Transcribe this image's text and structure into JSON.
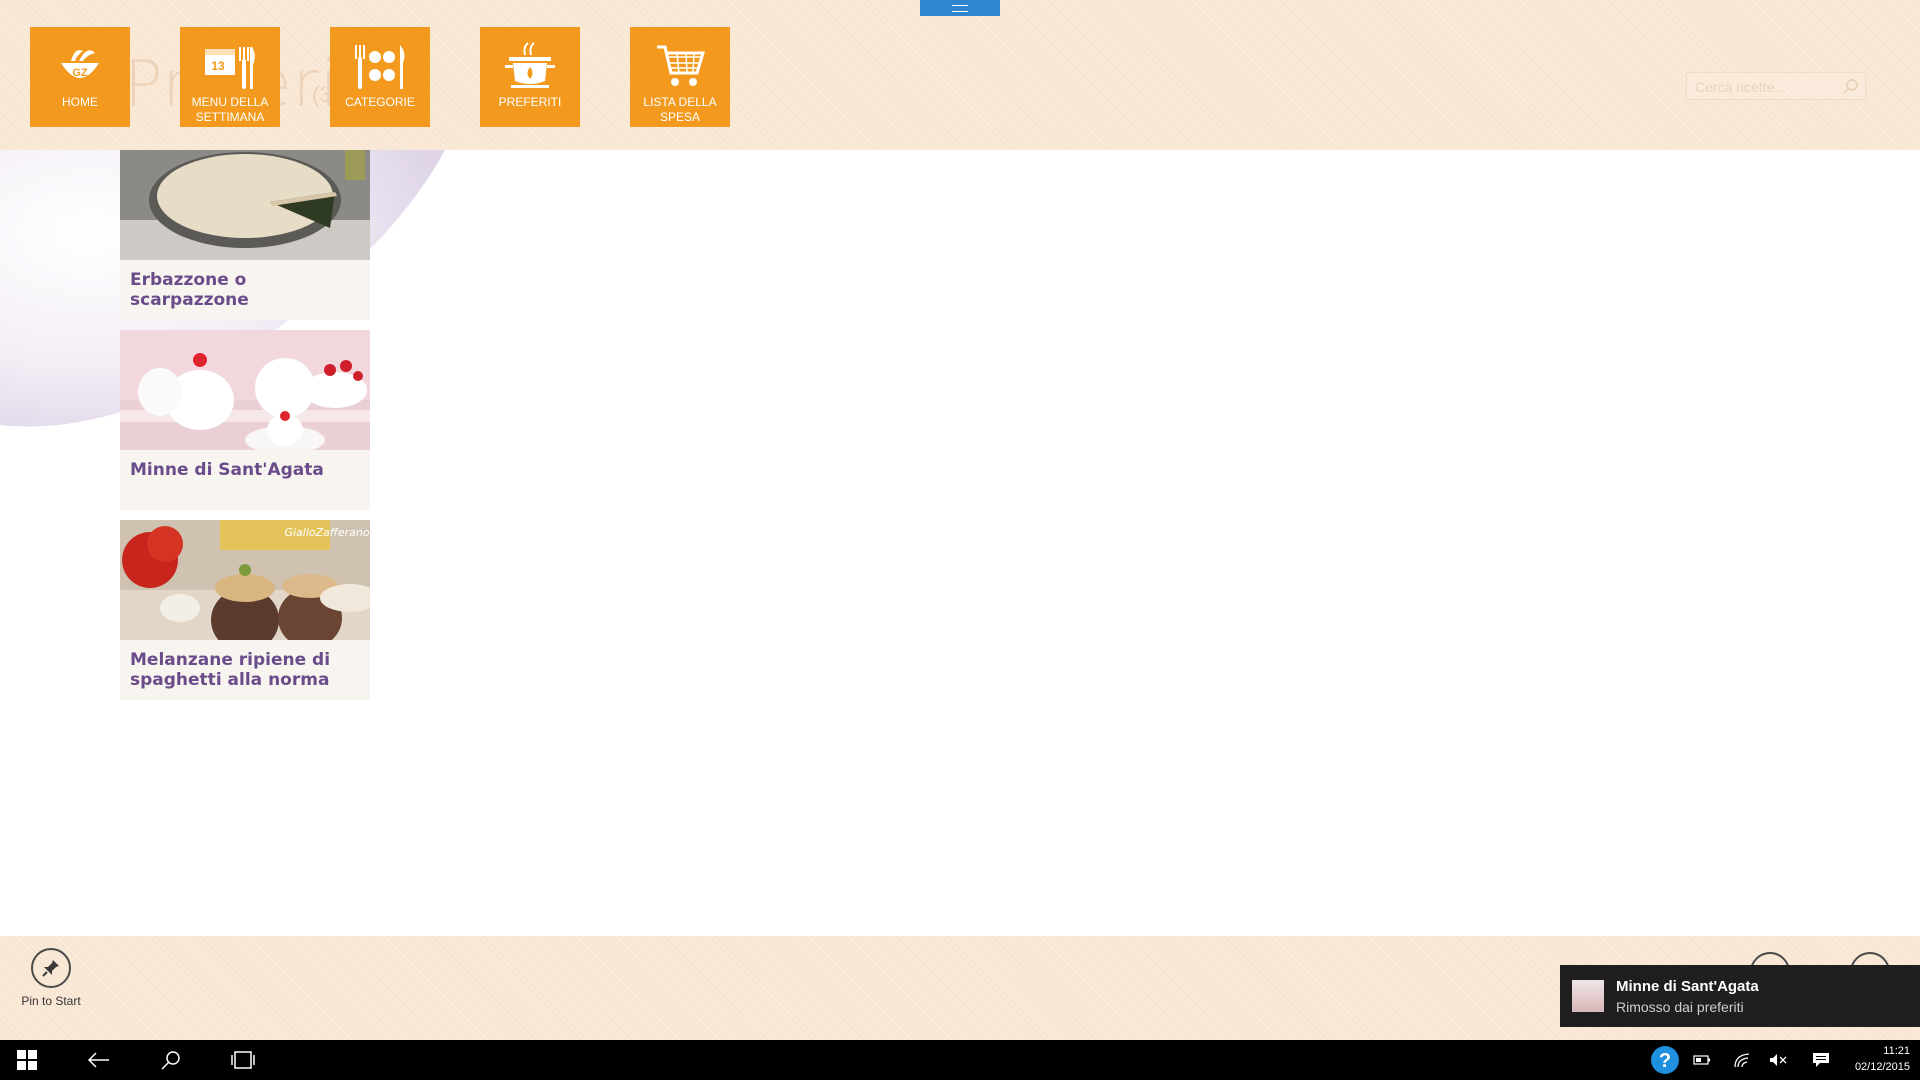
{
  "header": {
    "ghost_title": "Preferiti",
    "ghost_count": "(3)",
    "nav": [
      {
        "id": "home",
        "label": "HOME",
        "icon": "home-bowl-icon"
      },
      {
        "id": "menu",
        "label": "MENU DELLA SETTIMANA",
        "icon": "calendar-cutlery-icon"
      },
      {
        "id": "categorie",
        "label": "CATEGORIE",
        "icon": "categories-cutlery-icon"
      },
      {
        "id": "preferiti",
        "label": "PREFERITI",
        "icon": "cooking-pot-icon"
      },
      {
        "id": "lista",
        "label": "LISTA DELLA SPESA",
        "icon": "shopping-cart-icon"
      }
    ],
    "calendar_number": "13",
    "search_placeholder": "Cerca ricette..."
  },
  "recipes": [
    {
      "title": "Erbazzone o scarpazzone",
      "image": "erbazzone-pie-photo"
    },
    {
      "title": "Minne di Sant'Agata",
      "image": "minne-sant-agata-photo"
    },
    {
      "title": "Melanzane ripiene di spaghetti alla norma",
      "image": "melanzane-ripiene-photo"
    }
  ],
  "appbar": {
    "pin_label": "Pin to Start"
  },
  "toast": {
    "title": "Minne di Sant'Agata",
    "message": "Rimosso dai preferiti"
  },
  "taskbar": {
    "time": "11:21",
    "date": "02/12/2015"
  },
  "colors": {
    "accent_tile": "#f39a1e",
    "header_bg": "#fbe9d6",
    "title_purple": "#6a4c8a",
    "handle_blue": "#2e86d0"
  }
}
